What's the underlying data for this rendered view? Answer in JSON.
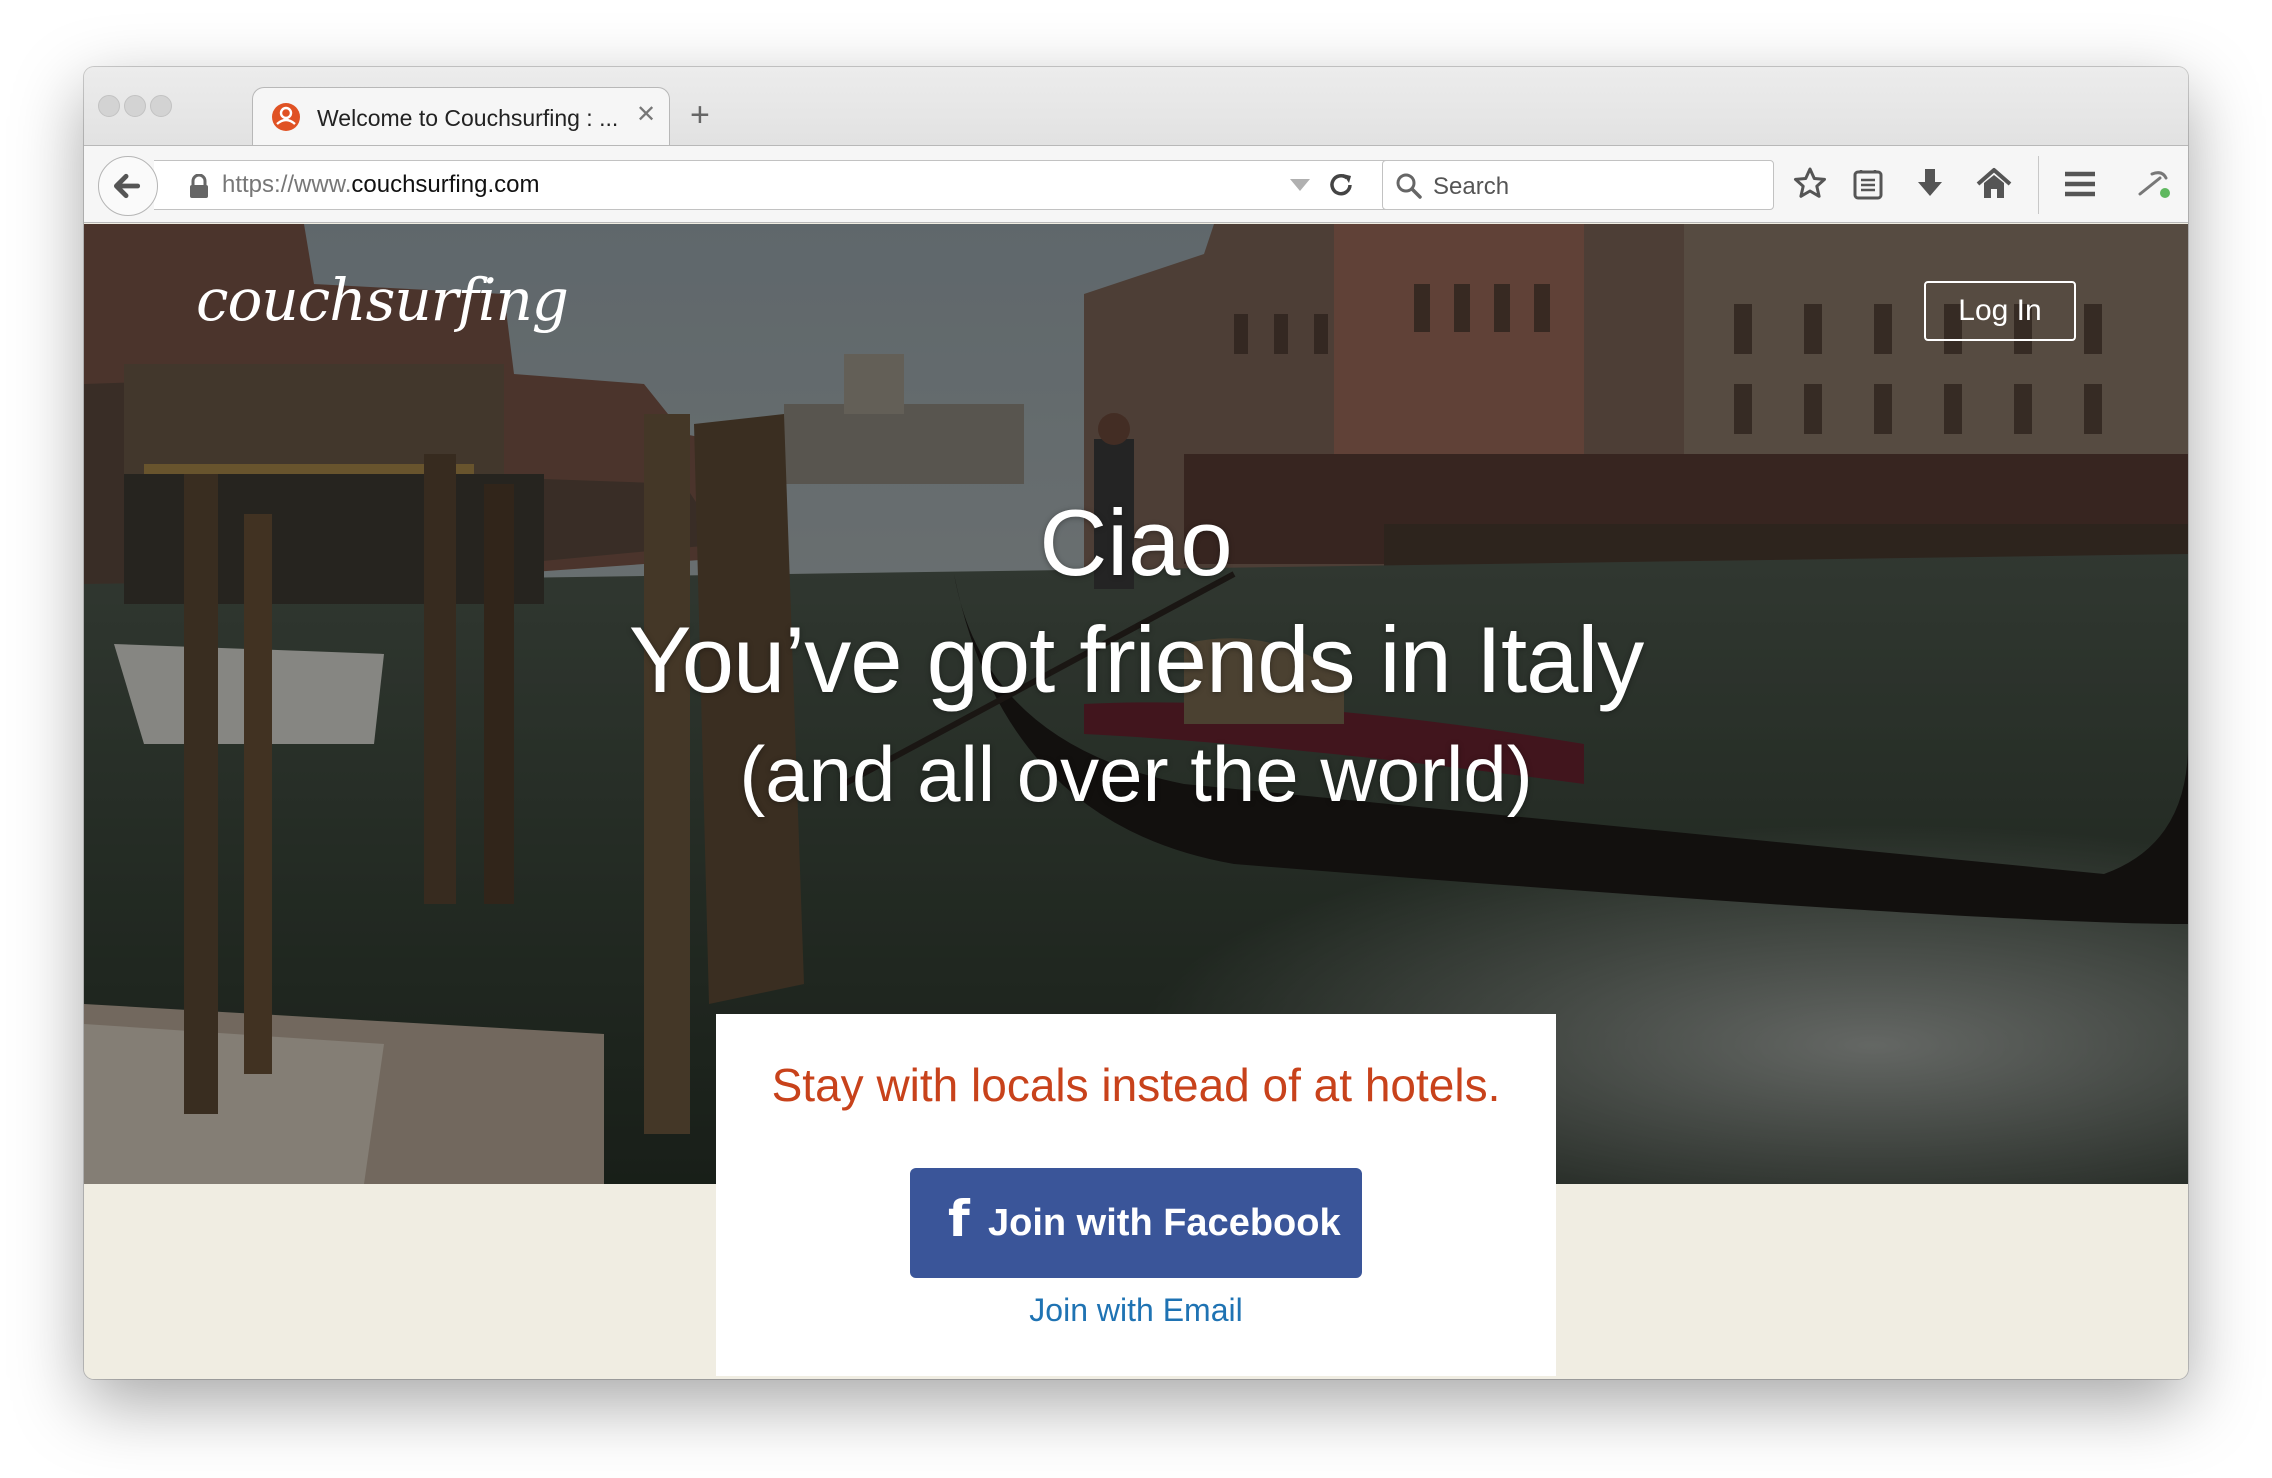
{
  "browser": {
    "tab_title": "Welcome to Couchsurfing : ...",
    "url_prefix": "https://www.",
    "url_host": "couchsurfing.com",
    "search_placeholder": "Search"
  },
  "page": {
    "logo_text": "couchsurfing",
    "login_label": "Log In",
    "greeting": "Ciao",
    "headline": "You’ve got friends in Italy",
    "subheadline": "(and all over the world)",
    "tagline": "Stay with locals instead of at hotels.",
    "facebook_label": "Join with Facebook",
    "facebook_icon": "f",
    "email_label": "Join with Email"
  },
  "colors": {
    "tagline": "#c8421b",
    "facebook_button": "#3a5599",
    "email_link": "#1f73b3",
    "page_background": "#f0ede2"
  }
}
